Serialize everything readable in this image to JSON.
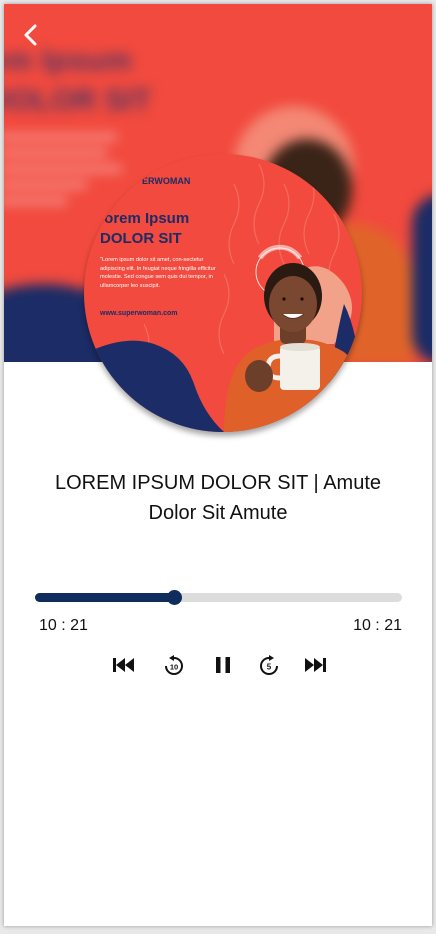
{
  "player": {
    "track_title": "LOREM IPSUM DOLOR SIT |  Amute\nDolor Sit Amute",
    "elapsed": "10 : 21",
    "total": "10 : 21",
    "progress_fraction": 0.38,
    "accent_color": "#0f2d5c",
    "track_bg_color": "#dcdcdc"
  },
  "album_art": {
    "brand": "ERWOMAN",
    "title_line1": ".orem Ipsum",
    "title_line2": "DOLOR SIT",
    "body": "\"Lorem ipsum dolor sit amet, con-sectetur adipiscing elit. In feugiat neque fringilla efficitur molestie. Sed congue sem quis dui tempor, in ullamcorper leo suscipit.",
    "url": "www.superwoman.com",
    "background_color": "#f24a3e",
    "navy_color": "#1b2c66"
  },
  "background": {
    "text_line1": "em Ipsum",
    "text_line2": "DOLOR SIT"
  },
  "icons": {
    "back": "chevron-left-icon",
    "skip_previous": "skip-previous-icon",
    "replay_10": "replay-10-icon",
    "pause": "pause-icon",
    "forward_5": "forward-5-icon",
    "skip_next": "skip-next-icon"
  }
}
